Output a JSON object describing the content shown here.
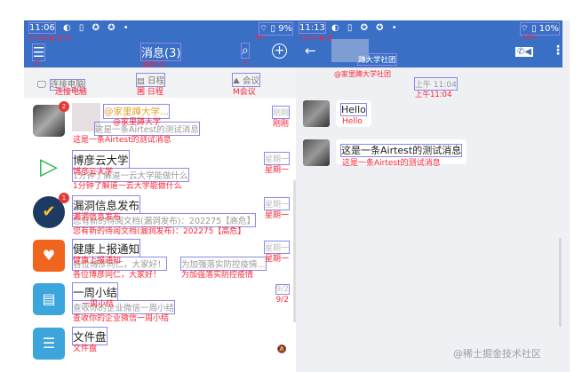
{
  "left": {
    "status": {
      "time": "11:06",
      "battery": "9%",
      "time_ann": "11:06 ◐ 目 ⚙",
      "battery_ann": "9%"
    },
    "toolbar": {
      "title": "消息(3)",
      "title_ann": "消息(3)",
      "menu_ann": "☰",
      "search_ann": "a"
    },
    "shortcuts": [
      {
        "label": "连接电脑",
        "ann": "连接电脑",
        "icon": "monitor-icon"
      },
      {
        "label": "日程",
        "ann": "圃 日程",
        "icon": "calendar-icon"
      },
      {
        "label": "会议",
        "ann": "M会议",
        "icon": "meeting-icon"
      }
    ],
    "items": [
      {
        "title": "@家里蹲大学...",
        "title_ann": "@家里蹲大学",
        "sub": "这是一条Airtest的测试消息",
        "sub_ann": "这是一条Airtest的测试消息",
        "time": "刚刚",
        "time_ann": "刚刚",
        "badge": "2"
      },
      {
        "title": "博彦云大学",
        "title_ann": "博彦云大学",
        "sub": "1分钟了解道一云大学能做什么",
        "sub_ann": "1分钟了解道一云大学能做什么",
        "time": "星期一",
        "time_ann": "星期一"
      },
      {
        "title": "漏洞信息发布",
        "title_ann": "漏洞信息发布",
        "sub": "您有新的待阅文档(漏洞发布)：202275【高危】",
        "sub_ann": "您有新的待阅文档(漏洞发布)：202275【高危】",
        "time": "星期一",
        "time_ann": "星期一",
        "badge": "1"
      },
      {
        "title": "健康上报通知",
        "title_ann": "健康上报通知",
        "sub": "各位博彦同仁，大家好！",
        "sub_ann": "各位博彦同仁，大家好！",
        "sub2": "为加强落实防控疫情...",
        "sub2_ann": "为加强落实防控疫情",
        "time": "星期一",
        "time_ann": "星期一"
      },
      {
        "title": "一周小结",
        "title_ann": "一周小结",
        "sub": "查收你的企业微信一周小结",
        "sub_ann": "查收你的企业微信一周小结",
        "time": "9/2",
        "time_ann": "9/2"
      },
      {
        "title": "文件盘",
        "title_ann": "文件盘"
      }
    ]
  },
  "right": {
    "status": {
      "time": "11:13",
      "battery": "10%",
      "time_ann": "11:13 ◐ 目",
      "battery_ann": "10%"
    },
    "toolbar": {
      "title": "蹲大学社团",
      "title_ann": "@家里蹲大学社团"
    },
    "timestamp": "上午 11:04",
    "timestamp_ann": "上午11:04",
    "messages": [
      {
        "text": "Hello",
        "ann": "Hello"
      },
      {
        "text": "这是一条Airtest的测试消息",
        "ann": "这是一条Airtest的测试消息"
      }
    ]
  },
  "watermark": "@稀土掘金技术社区",
  "colors": {
    "primary": "#3a6fc6",
    "annotation_text": "#ff2233",
    "annotation_box": "#8a8ae8"
  }
}
